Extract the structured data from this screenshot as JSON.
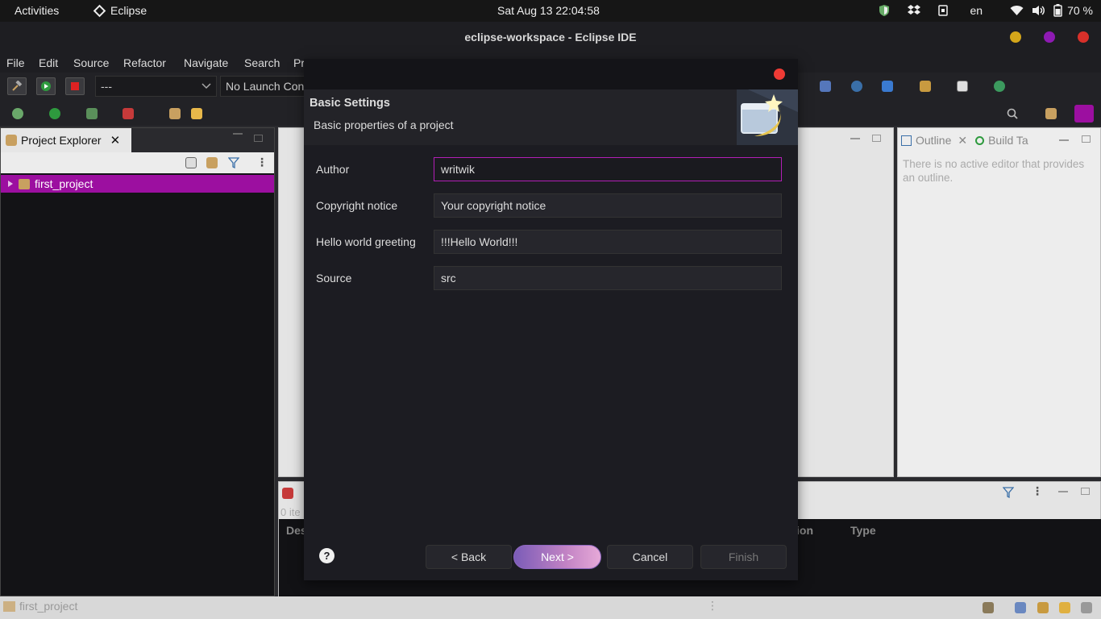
{
  "topbar": {
    "activities": "Activities",
    "app_name": "Eclipse",
    "clock": "Sat Aug 13  22:04:58",
    "lang": "en",
    "battery": "70 %"
  },
  "window": {
    "title": "eclipse-workspace - Eclipse IDE",
    "button_colors": [
      "#d4a61a",
      "#8e1ab3",
      "#d8302a"
    ]
  },
  "menubar": [
    "File",
    "Edit",
    "Source",
    "Refactor",
    "Navigate",
    "Search",
    "Pr"
  ],
  "toolbar": {
    "launch_mode": "---",
    "launch_config": "No Launch Con"
  },
  "project_explorer": {
    "tab_label": "Project Explorer",
    "items": [
      {
        "label": "first_project"
      }
    ]
  },
  "outline": {
    "tab_label": "Outline",
    "build_tab_label": "Build Ta",
    "message": "There is no active editor that provides an outline."
  },
  "problems": {
    "items_count": "0 ite",
    "col_description": "Des",
    "col_location": "ion",
    "col_type": "Type"
  },
  "statusbar": {
    "selection": "first_project"
  },
  "dialog": {
    "heading": "Basic Settings",
    "description": "Basic properties of a project",
    "fields": [
      {
        "label": "Author",
        "value": "writwik"
      },
      {
        "label": "Copyright notice",
        "value": "Your copyright notice"
      },
      {
        "label": "Hello world greeting",
        "value": "!!!Hello World!!!"
      },
      {
        "label": "Source",
        "value": "src"
      }
    ],
    "buttons": {
      "help": "?",
      "back": "< Back",
      "next": "Next >",
      "cancel": "Cancel",
      "finish": "Finish"
    }
  },
  "colors": {
    "accent": "#9c0fa0",
    "dialog_bg": "#1c1c22",
    "primary_button": "#c283c4"
  }
}
